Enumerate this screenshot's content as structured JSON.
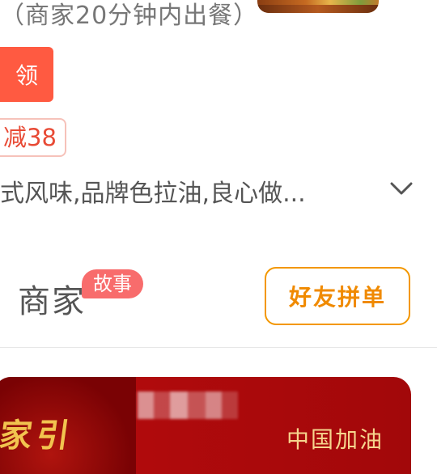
{
  "store": {
    "prep_note": "（商家20分钟内出餐）",
    "claim_label": "领",
    "discount_label": "减38",
    "description": "式风味,品牌色拉油,良心做..."
  },
  "merchant": {
    "title": "商家",
    "badge": "故事"
  },
  "actions": {
    "group_order_label": "好友拼单"
  },
  "banner": {
    "art_text": "家引",
    "caption": "中国加油"
  },
  "colors": {
    "accent_red": "#ff5a41",
    "accent_orange": "#f39700",
    "badge_pink": "#f86c6c",
    "banner_red": "#a2080a"
  },
  "icons": [
    "chevron-down-icon"
  ]
}
